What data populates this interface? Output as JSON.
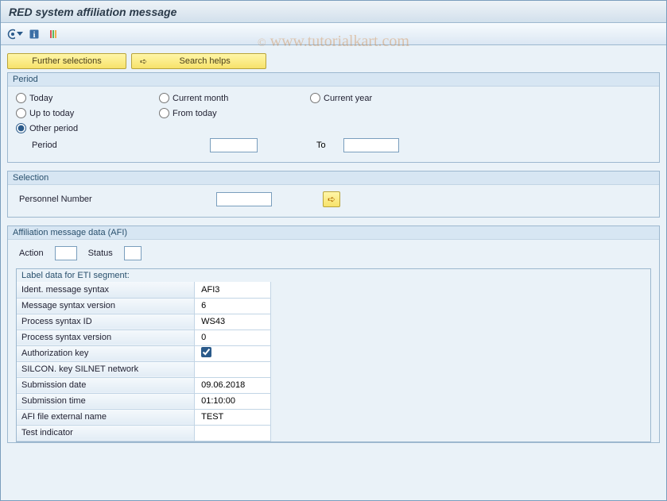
{
  "title": "RED system affiliation message",
  "watermark": {
    "copy": "©",
    "text": "www.tutorialkart.com"
  },
  "toolbar": {
    "execute_icon": "execute",
    "info_icon": "info",
    "variant_icon": "variant"
  },
  "buttons": {
    "further_selections": "Further selections",
    "search_helps": "Search helps",
    "search_helps_glyph": "➪"
  },
  "period": {
    "legend": "Period",
    "today": "Today",
    "current_month": "Current month",
    "current_year": "Current year",
    "up_to_today": "Up to today",
    "from_today": "From today",
    "other_period": "Other period",
    "period_label": "Period",
    "to_label": "To",
    "period_from_value": "",
    "period_to_value": "",
    "selected": "other_period"
  },
  "selection": {
    "legend": "Selection",
    "personnel_number": "Personnel Number",
    "personnel_number_value": "",
    "multi_glyph": "➪"
  },
  "afi": {
    "legend": "Affiliation message data (AFI)",
    "action_label": "Action",
    "action_value": "",
    "status_label": "Status",
    "status_value": "",
    "eti": {
      "legend": "Label data for ETI segment:",
      "fields": [
        {
          "label": "Ident. message syntax",
          "value": "AFI3",
          "type": "text"
        },
        {
          "label": "Message syntax version",
          "value": "6",
          "type": "text"
        },
        {
          "label": "Process syntax ID",
          "value": "WS43",
          "type": "text"
        },
        {
          "label": "Process syntax version",
          "value": "0",
          "type": "text"
        },
        {
          "label": "Authorization key",
          "value": "true",
          "type": "checkbox"
        },
        {
          "label": "SILCON. key SILNET network",
          "value": "",
          "type": "text"
        },
        {
          "label": "Submission date",
          "value": "09.06.2018",
          "type": "text"
        },
        {
          "label": "Submission time",
          "value": "01:10:00",
          "type": "text"
        },
        {
          "label": "AFI file external name",
          "value": "TEST",
          "type": "text"
        },
        {
          "label": "Test indicator",
          "value": "",
          "type": "text"
        }
      ]
    }
  }
}
